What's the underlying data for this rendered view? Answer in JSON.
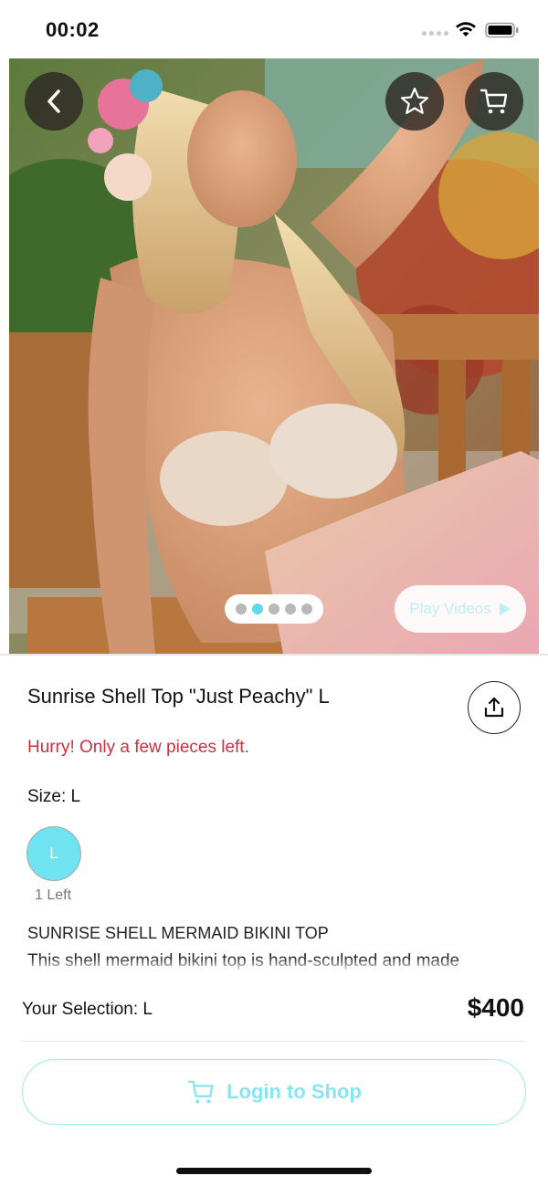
{
  "status_bar": {
    "time": "00:02"
  },
  "hero": {
    "icons": {
      "back": "chevron-left-icon",
      "favorite": "star-icon",
      "cart": "cart-icon"
    },
    "pager": {
      "count": 5,
      "active_index": 1
    },
    "play_videos_label": "Play Videos"
  },
  "product": {
    "title": "Sunrise Shell Top \"Just Peachy\" L",
    "stock_message": "Hurry! Only a few pieces left.",
    "size_label": "Size: L",
    "size_option": "L",
    "size_stock": "1 Left",
    "description_title": "SUNRISE SHELL MERMAID BIKINI TOP",
    "description_text": "This shell mermaid bikini top is hand-sculpted and made"
  },
  "bottom": {
    "selection": "Your Selection: L",
    "price": "$400",
    "login_label": "Login to Shop"
  },
  "colors": {
    "accent": "#6fe3ef",
    "warning": "#c8323f",
    "button_text": "#88e4ee"
  }
}
